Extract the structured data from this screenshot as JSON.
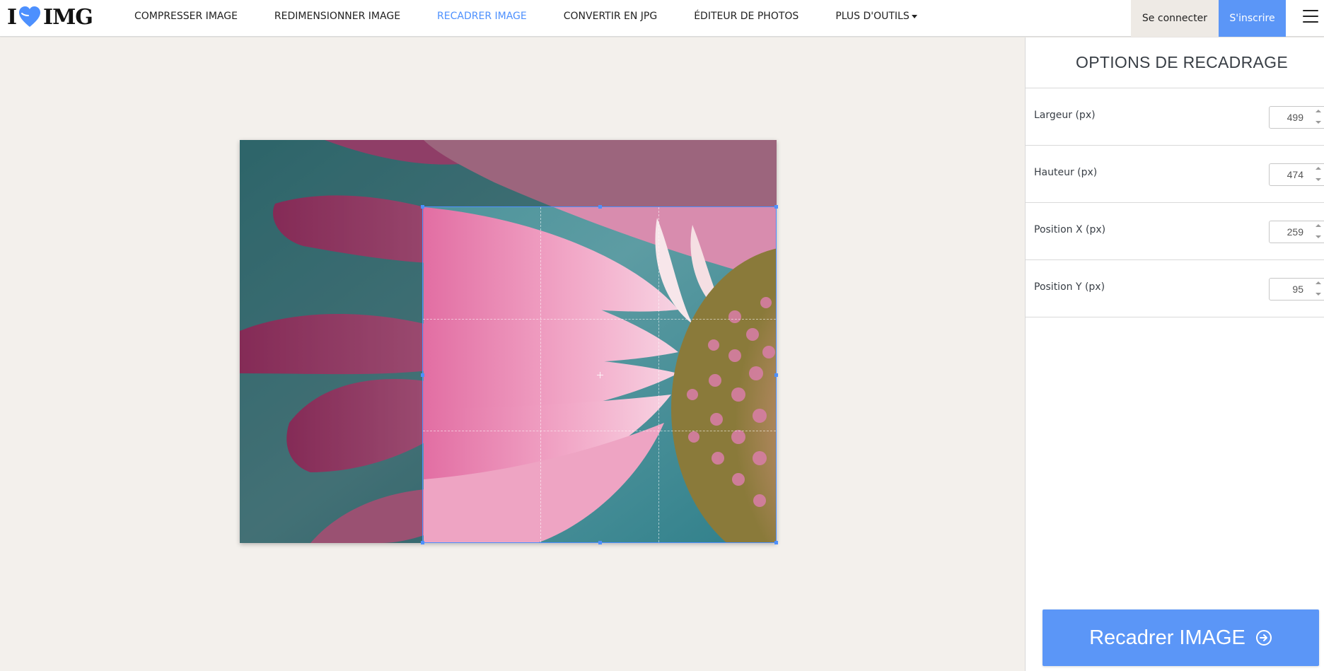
{
  "brand": {
    "logo_left": "I",
    "logo_right": "IMG",
    "heart_icon": "heart-icon",
    "heart_color": "#4d90fe"
  },
  "nav": {
    "items": [
      {
        "label": "COMPRESSER IMAGE",
        "active": false
      },
      {
        "label": "REDIMENSIONNER IMAGE",
        "active": false
      },
      {
        "label": "RECADRER IMAGE",
        "active": true
      },
      {
        "label": "CONVERTIR EN JPG",
        "active": false
      },
      {
        "label": "ÉDITEUR DE PHOTOS",
        "active": false
      },
      {
        "label": "PLUS D'OUTILS",
        "active": false,
        "dropdown": true
      }
    ],
    "active_color": "#4d90fe"
  },
  "auth": {
    "login_label": "Se connecter",
    "signup_label": "S'inscrire",
    "signup_color": "#5b96f7"
  },
  "menu_icon": "hamburger-menu-icon",
  "sidebar": {
    "title": "OPTIONS DE RECADRAGE",
    "options": [
      {
        "label": "Largeur (px)",
        "value": "499"
      },
      {
        "label": "Hauteur (px)",
        "value": "474"
      },
      {
        "label": "Position X (px)",
        "value": "259"
      },
      {
        "label": "Position Y (px)",
        "value": "95"
      }
    ],
    "submit_label": "Recadrer IMAGE",
    "submit_icon": "arrow-circle-right-icon",
    "accent_color": "#5b96f7"
  }
}
